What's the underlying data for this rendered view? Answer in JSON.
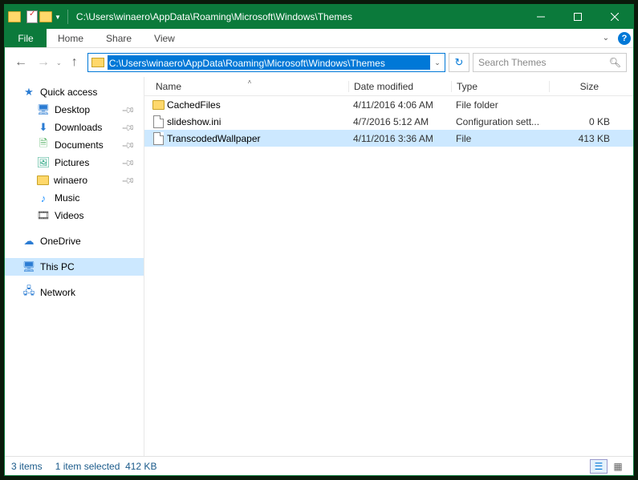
{
  "title": "C:\\Users\\winaero\\AppData\\Roaming\\Microsoft\\Windows\\Themes",
  "ribbon": {
    "file": "File",
    "home": "Home",
    "share": "Share",
    "view": "View"
  },
  "address": {
    "path": "C:\\Users\\winaero\\AppData\\Roaming\\Microsoft\\Windows\\Themes",
    "search_placeholder": "Search Themes"
  },
  "sidebar": {
    "quick_access": "Quick access",
    "items": [
      {
        "label": "Desktop",
        "pinned": true
      },
      {
        "label": "Downloads",
        "pinned": true
      },
      {
        "label": "Documents",
        "pinned": true
      },
      {
        "label": "Pictures",
        "pinned": true
      },
      {
        "label": "winaero",
        "pinned": true
      },
      {
        "label": "Music",
        "pinned": false
      },
      {
        "label": "Videos",
        "pinned": false
      }
    ],
    "onedrive": "OneDrive",
    "this_pc": "This PC",
    "network": "Network"
  },
  "columns": {
    "name": "Name",
    "date": "Date modified",
    "type": "Type",
    "size": "Size"
  },
  "files": [
    {
      "name": "CachedFiles",
      "date": "4/11/2016 4:06 AM",
      "type": "File folder",
      "size": "",
      "kind": "folder",
      "selected": false
    },
    {
      "name": "slideshow.ini",
      "date": "4/7/2016 5:12 AM",
      "type": "Configuration sett...",
      "size": "0 KB",
      "kind": "file",
      "selected": false
    },
    {
      "name": "TranscodedWallpaper",
      "date": "4/11/2016 3:36 AM",
      "type": "File",
      "size": "413 KB",
      "kind": "file",
      "selected": true
    }
  ],
  "status": {
    "items": "3 items",
    "selected": "1 item selected",
    "size": "412 KB"
  }
}
